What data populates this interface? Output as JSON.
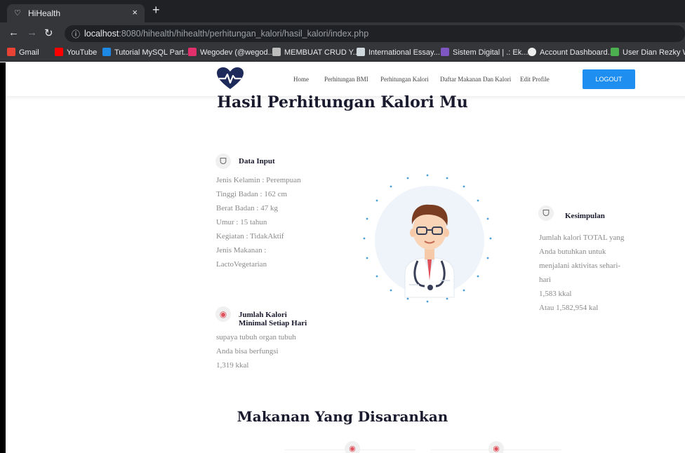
{
  "browser": {
    "tab_title": "HiHealth",
    "tab_close": "×",
    "new_tab": "+",
    "url_host": "localhost",
    "url_rest": ":8080/hihealth/hihealth/perhitungan_kalori/hasil_kalori/index.php",
    "bookmarks": [
      {
        "label": "Gmail",
        "color": "#ea4335"
      },
      {
        "label": "YouTube",
        "color": "#ff0000"
      },
      {
        "label": "Tutorial MySQL Part...",
        "color": "#1e88e5"
      },
      {
        "label": "Wegodev (@wegod...",
        "color": "#e1306c"
      },
      {
        "label": "MEMBUAT CRUD Y...",
        "color": "#bdbdbd"
      },
      {
        "label": "International Essay...",
        "color": "#cfd8dc"
      },
      {
        "label": "Sistem Digital | .: Ek...",
        "color": "#7e57c2"
      },
      {
        "label": "Account Dashboard...",
        "color": "#eeeeee"
      },
      {
        "label": "User Dian Rezky W...",
        "color": "#4caf50"
      }
    ]
  },
  "nav": {
    "home": "Home",
    "bmi": "Perhitungan BMI",
    "kalori": "Perhitungan Kalori",
    "daftar": "Daftar Makanan Dan Kalori",
    "edit": "Edit Profile",
    "logout": "LOGOUT"
  },
  "page": {
    "title": "Hasil Perhitungan Kalori Mu",
    "input": {
      "title": "Data Input",
      "lines": [
        "Jenis Kelamin : Perempuan",
        "Tinggi Badan : 162 cm",
        "Berat Badan : 47 kg",
        "Umur : 15 tahun",
        "Kegiatan : TidakAktif",
        "Jenis Makanan :",
        "LactoVegetarian"
      ]
    },
    "minimal": {
      "title_1": "Jumlah Kalori",
      "title_2": "Minimal Setiap Hari",
      "lines": [
        "supaya tubuh organ tubuh",
        "Anda bisa berfungsi",
        "1,319 kkal"
      ]
    },
    "kesimpulan": {
      "title": "Kesimpulan",
      "lines": [
        "Jumlah kalori TOTAL yang",
        "Anda butuhkan untuk",
        "menjalani aktivitas sehari-",
        "hari",
        "1,583 kkal",
        "Atau 1,582,954 kal"
      ]
    },
    "food_title": "Makanan Yang Disarankan"
  },
  "colors": {
    "accent": "#1f8ef1",
    "logo": "#1e2a5a"
  }
}
